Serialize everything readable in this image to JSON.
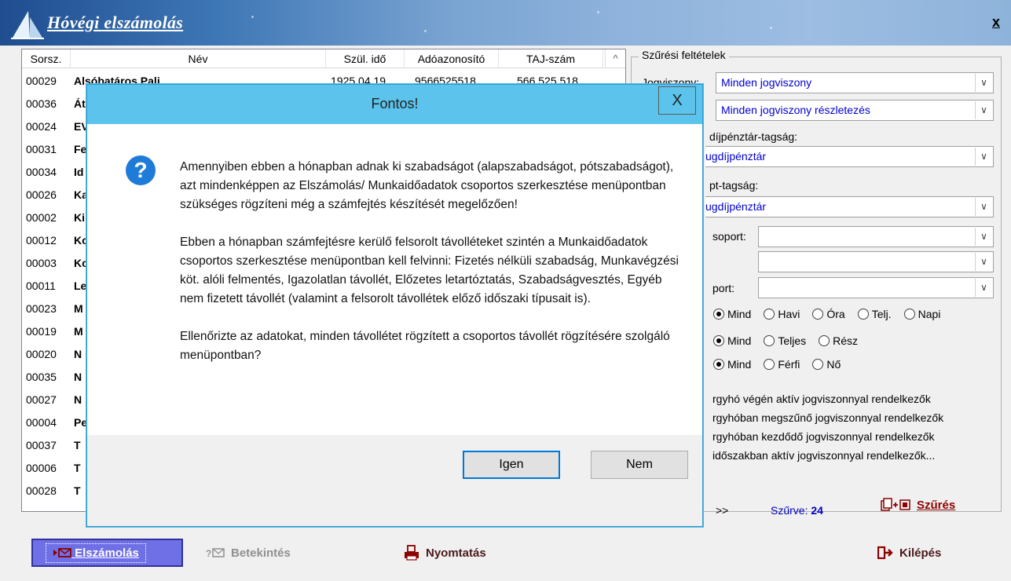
{
  "app": {
    "title": "Hóvégi elszámolás",
    "close": "x"
  },
  "list": {
    "columns": [
      "Sorsz.",
      "Név",
      "Szül. idő",
      "Adóazonosító",
      "TAJ-szám"
    ],
    "rows": [
      {
        "code": "00029",
        "name": "Alsóbatáros Pali",
        "birth": "1925.04.19",
        "tax": "9566525518",
        "taj": "566 525 518"
      },
      {
        "code": "00036",
        "name": "Át"
      },
      {
        "code": "00024",
        "name": "EV"
      },
      {
        "code": "00031",
        "name": "Fe"
      },
      {
        "code": "00034",
        "name": "Id"
      },
      {
        "code": "00026",
        "name": "Ka"
      },
      {
        "code": "00002",
        "name": "Ki"
      },
      {
        "code": "00012",
        "name": "Ko"
      },
      {
        "code": "00003",
        "name": "Ko"
      },
      {
        "code": "00011",
        "name": "Le"
      },
      {
        "code": "00023",
        "name": "M"
      },
      {
        "code": "00019",
        "name": "M"
      },
      {
        "code": "00020",
        "name": "N"
      },
      {
        "code": "00035",
        "name": "N"
      },
      {
        "code": "00027",
        "name": "N"
      },
      {
        "code": "00004",
        "name": "Pe"
      },
      {
        "code": "00037",
        "name": "T"
      },
      {
        "code": "00006",
        "name": "T"
      },
      {
        "code": "00028",
        "name": "T"
      }
    ]
  },
  "filter": {
    "title": "Szűrési feltételek",
    "jogviszony_label": "Jogviszony:",
    "jogviszony_value": "Minden jogviszony",
    "jogviszony_detail_value": "Minden jogviszony részletezés",
    "nyugdij_label": "díjpénztár-tagság:",
    "nyugdij_value": "ugdíjpénztár",
    "ept_label": "pt-tagság:",
    "ept_value": "ugdíjpénztár",
    "csoport_label": "soport:",
    "csoport2_label": "port:",
    "radio_rows": [
      [
        "Mind",
        "Havi",
        "Óra",
        "Telj.",
        "Napi"
      ],
      [
        "Mind",
        "Teljes",
        "Rész"
      ],
      [
        "Mind",
        "Férfi",
        "Nő"
      ]
    ],
    "checks": [
      "rgyhó végén aktív jogviszonnyal rendelkezők",
      "rgyhóban megszűnő jogviszonnyal rendelkezők",
      "rgyhóban kezdődő jogviszonnyal rendelkezők",
      "időszakban aktív jogviszonnyal rendelkezők..."
    ],
    "more": ">>",
    "filtered_label": "Szűrve:",
    "filtered_count": "24",
    "filter_button": "Szűrés"
  },
  "bottom": {
    "elszamolas": "Elszámolás",
    "betekintes": "Betekintés",
    "nyomtatas": "Nyomtatás",
    "kilepes": "Kilépés"
  },
  "dialog": {
    "title": "Fontos!",
    "close": "X",
    "icon": "question-icon",
    "paragraphs": [
      "Amennyiben ebben a hónapban adnak ki szabadságot (alapszabadságot, pótszabadságot), azt mindenképpen az Elszámolás/ Munkaidőadatok csoportos szerkesztése menüpontban szükséges rögzíteni még a számfejtés készítését megelőzően!",
      "Ebben a hónapban számfejtésre kerülő felsorolt távolléteket szintén a Munkaidőadatok csoportos szerkesztése menüpontban kell felvinni: Fizetés nélküli szabadság, Munkavégzési köt. alóli felmentés, Igazolatlan távollét, Előzetes letartóztatás, Szabadságvesztés, Egyéb nem fizetett távollét (valamint a felsorolt távollétek előző időszaki típusait is).",
      "Ellenőrizte az adatokat, minden távollétet rögzített a csoportos távollét rögzítésére szolgáló menüpontban?"
    ],
    "yes": "Igen",
    "no": "Nem"
  }
}
